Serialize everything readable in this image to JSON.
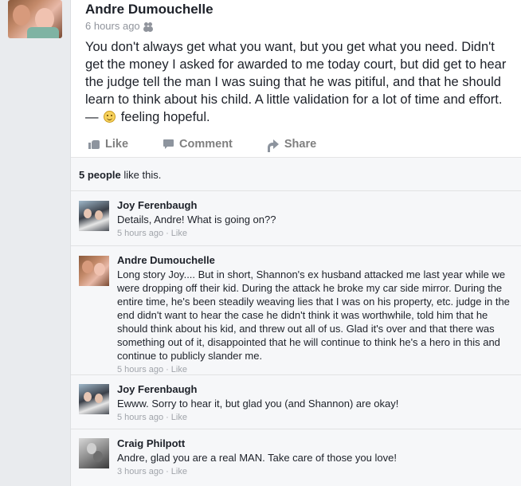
{
  "post": {
    "author": "Andre Dumouchelle",
    "time": "6 hours ago",
    "text_main": "You don't always get what you want, but you get what you need.  Didn't get the money I asked for awarded to me today court, but did get to hear the judge tell the man I was suing that he was pitiful, and that he should learn to think about his child.  A little validation for a lot of time and effort. —",
    "feeling": "feeling hopeful."
  },
  "actions": {
    "like": "Like",
    "comment": "Comment",
    "share": "Share"
  },
  "likes": {
    "count_text": "5 people",
    "suffix": " like this."
  },
  "comments": [
    {
      "name": "Joy Ferenbaugh",
      "text": "Details, Andre!  What is going on??",
      "time": "5 hours ago",
      "like": "Like"
    },
    {
      "name": "Andre Dumouchelle",
      "text": "Long story Joy.... But in short, Shannon's ex husband attacked me last year while we were dropping off their kid. During the attack he broke my car side mirror. During the entire time, he's been steadily weaving lies that I was on his property, etc. judge in the end didn't want to hear the case he didn't think it was worthwhile, told him that he should think about his kid, and threw out all of us. Glad it's over and that there was something out of it, disappointed that he will continue to think he's a hero in this and continue to publicly slander me.",
      "time": "5 hours ago",
      "like": "Like"
    },
    {
      "name": "Joy Ferenbaugh",
      "text": "Ewww.  Sorry to hear it, but glad you (and Shannon) are okay!",
      "time": "5 hours ago",
      "like": "Like"
    },
    {
      "name": "Craig Philpott",
      "text": "Andre, glad you are a real MAN. Take care of those you love!",
      "time": "3 hours ago",
      "like": "Like"
    }
  ]
}
